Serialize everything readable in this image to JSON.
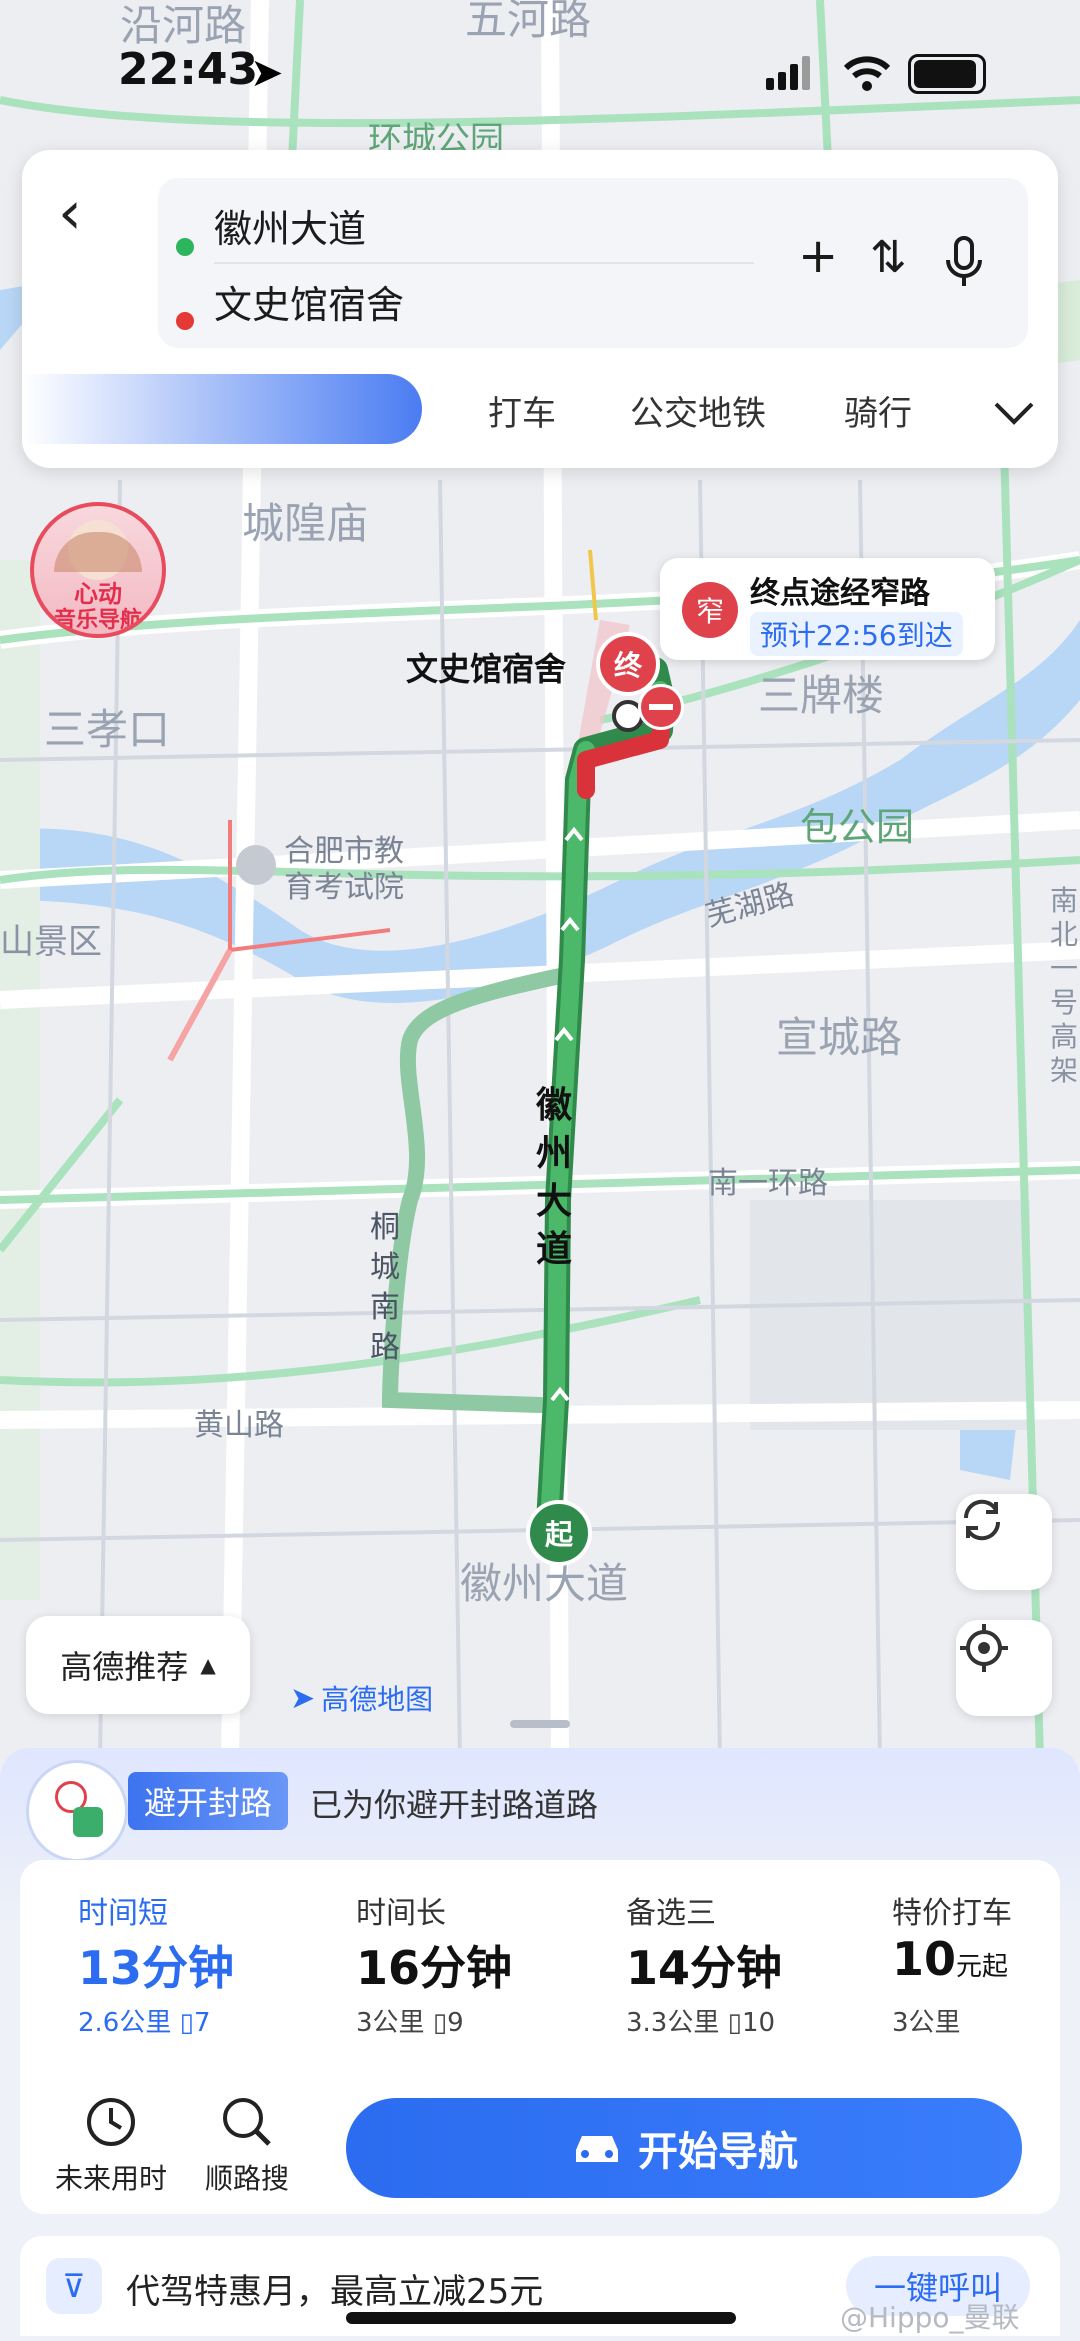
{
  "status_bar": {
    "time": "22:43"
  },
  "route": {
    "origin": "徽州大道",
    "destination": "文史馆宿舍",
    "origin_color": "#2db55d",
    "destination_color": "#e53935"
  },
  "modes": {
    "tabs": [
      "打车",
      "公交地铁",
      "骑行"
    ]
  },
  "map": {
    "labels": {
      "yanhe_road": "沿河路",
      "wuhe_road": "五河路",
      "huancheng_park": "环城公园",
      "chenghuang_temple": "城隍庙",
      "sanxiaokou": "三孝口",
      "sanpailou": "三牌楼",
      "baogong_park": "包公园",
      "wuhu_road": "芜湖路",
      "xuancheng_road": "宣城路",
      "nanyihuan_road": "南一环路",
      "huangshan_road": "黄山路",
      "tongcheng_south_road": "桐城南路",
      "huizhou_avenue_route": "徽州大道",
      "huizhou_avenue_bottom": "徽州大道",
      "exam_institute": "合肥市教育考试院",
      "scenic_area": "山景区",
      "destination_label": "文史馆宿舍",
      "right_edge_road": "南北一号高架"
    },
    "start_marker": "起",
    "end_marker": "终",
    "narrow_road": {
      "badge": "窄",
      "title": "终点途经窄路",
      "eta": "预计22:56到达"
    },
    "avatar_text_line1": "心动",
    "avatar_text_line2": "音乐导航",
    "gaode_recommend": "高德推荐",
    "map_brand": "高德地图"
  },
  "sheet": {
    "avoid_badge": "避开封路",
    "avoid_text": "已为你避开封路道路",
    "options": [
      {
        "label": "时间短",
        "time": "13分钟",
        "distance": "2.6公里",
        "lights": "7",
        "selected": true
      },
      {
        "label": "时间长",
        "time": "16分钟",
        "distance": "3公里",
        "lights": "9",
        "selected": false
      },
      {
        "label": "备选三",
        "time": "14分钟",
        "distance": "3.3公里",
        "lights": "10",
        "selected": false
      },
      {
        "label": "特价打车",
        "time_number": "10",
        "time_unit": "元起",
        "distance": "3公里"
      }
    ],
    "future_time": "未来用时",
    "along_search": "顺路搜",
    "start_nav": "开始导航",
    "promo_text": "代驾特惠月，最高立减25元",
    "promo_button": "一键呼叫",
    "watermark": "@Hippo_曼联"
  },
  "colors": {
    "accent": "#2b6cf0",
    "route_green": "#4cb86a",
    "congestion_red": "#d9323b"
  }
}
